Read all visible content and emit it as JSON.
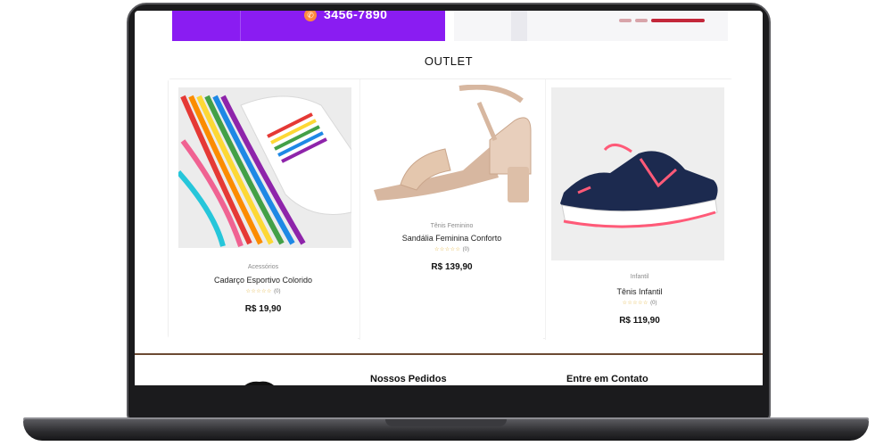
{
  "header": {
    "phone_number": "3456-7890"
  },
  "carousel": {
    "slide_count": 3,
    "active_slide": 3
  },
  "outlet": {
    "title": "OUTLET",
    "products": [
      {
        "category": "Acessórios",
        "name": "Cadarço Esportivo Colorido",
        "rating_stars": "☆☆☆☆☆",
        "rating_count": "(0)",
        "price": "R$ 19,90",
        "image": "rainbow-laces-image"
      },
      {
        "category": "Tênis Feminino",
        "name": "Sandália Feminina Conforto",
        "rating_stars": "☆☆☆☆☆",
        "rating_count": "(0)",
        "price": "R$ 139,90",
        "image": "nude-sandal-image"
      },
      {
        "category": "Infantil",
        "name": "Tênis Infantil",
        "rating_stars": "☆☆☆☆☆",
        "rating_count": "(0)",
        "price": "R$ 119,90",
        "image": "navy-sneaker-image"
      }
    ]
  },
  "footer": {
    "orders_heading": "Nossos Pedidos",
    "contact_heading": "Entre em Contato"
  },
  "colors": {
    "promo_purple": "#8a1cf2",
    "carousel_active": "#c3273a",
    "footer_rule": "#6b4a33",
    "star_color": "#e2b23b"
  }
}
